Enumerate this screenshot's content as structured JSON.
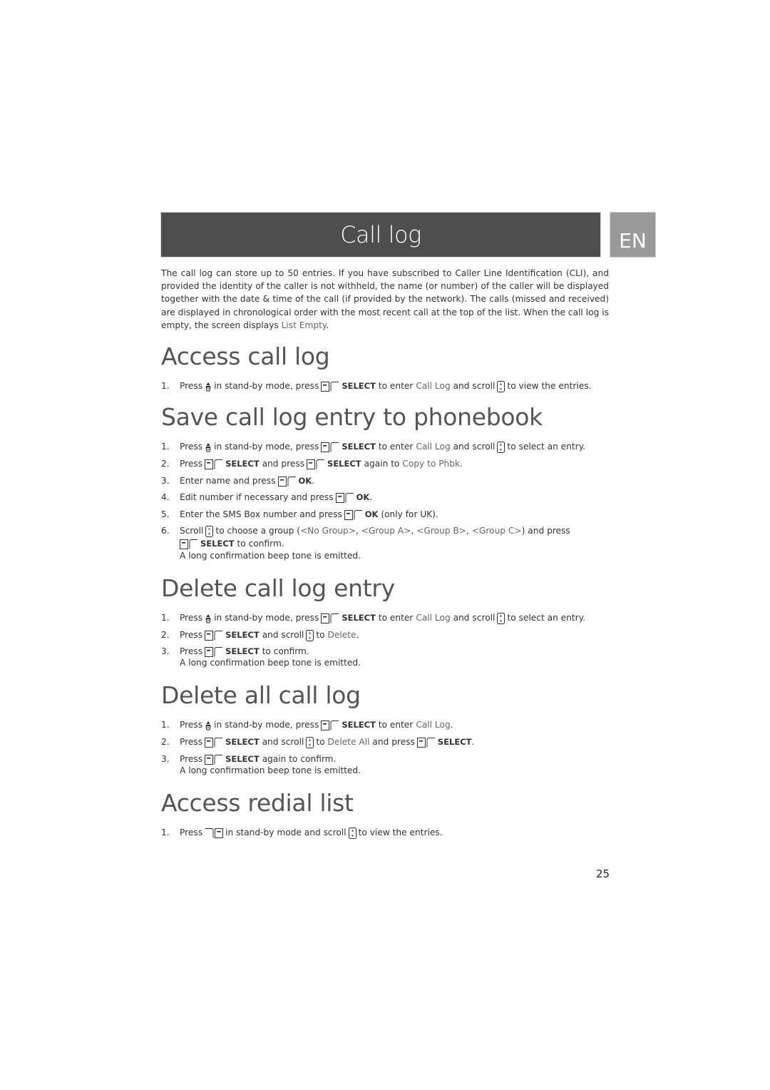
{
  "header": {
    "title": "Call log",
    "language": "EN"
  },
  "intro": "The call log can store up to 50 entries. If you have subscribed to Caller Line Identification (CLI), and provided the identity of the caller is not withheld, the name (or number) of the caller will be displayed together with the date & time of the call (if provided by the network). The calls (missed and received) are displayed in chronological order with the most recent call at the top of the list. When the call log is empty, the screen displays ",
  "intro_menu": "List Empty",
  "intro_end": ".",
  "sections": {
    "access_call_log": {
      "title": "Access call log",
      "steps": [
        {
          "num": "1.",
          "parts": [
            "Press",
            "in stand-by mode, press",
            "SELECT",
            "to enter",
            "Call Log",
            "and scroll",
            "to view the entries."
          ]
        }
      ]
    },
    "save_entry": {
      "title": "Save call log entry to phonebook",
      "steps": [
        {
          "num": "1.",
          "parts": [
            "Press",
            "in stand-by mode, press",
            "SELECT",
            "to enter",
            "Call Log",
            "and scroll",
            "to select an entry."
          ]
        },
        {
          "num": "2.",
          "parts": [
            "Press",
            "SELECT",
            "and press",
            "SELECT",
            "again to",
            "Copy to Phbk",
            "."
          ]
        },
        {
          "num": "3.",
          "parts": [
            "Enter name and press",
            "OK",
            "."
          ]
        },
        {
          "num": "4.",
          "parts": [
            "Edit number if necessary and press",
            "OK",
            "."
          ]
        },
        {
          "num": "5.",
          "parts": [
            "Enter the SMS Box number and press",
            "OK",
            "(only for UK)."
          ]
        },
        {
          "num": "6.",
          "parts": [
            "Scroll",
            "to choose a group (",
            "<No Group>",
            ", ",
            "<Group A>",
            ", ",
            "<Group B>",
            ", ",
            "<Group C>",
            ") and press",
            "SELECT",
            "to confirm."
          ]
        }
      ],
      "note": "A long confirmation beep tone is emitted."
    },
    "delete_entry": {
      "title": "Delete call log entry",
      "steps": [
        {
          "num": "1.",
          "parts": [
            "Press",
            "in stand-by mode, press",
            "SELECT",
            "to enter",
            "Call Log",
            "and scroll",
            "to select an entry."
          ]
        },
        {
          "num": "2.",
          "parts": [
            "Press",
            "SELECT",
            "and scroll",
            "to",
            "Delete",
            "."
          ]
        },
        {
          "num": "3.",
          "parts": [
            "Press",
            "SELECT",
            "to confirm."
          ]
        }
      ],
      "note": "A long confirmation beep tone is emitted."
    },
    "delete_all": {
      "title": "Delete all call log",
      "steps": [
        {
          "num": "1.",
          "parts": [
            "Press",
            "in stand-by mode, press",
            "SELECT",
            "to enter",
            "Call Log",
            "."
          ]
        },
        {
          "num": "2.",
          "parts": [
            "Press",
            "SELECT",
            "and scroll",
            "to",
            "Delete All",
            "and press",
            "SELECT",
            "."
          ]
        },
        {
          "num": "3.",
          "parts": [
            "Press",
            "SELECT",
            "again to confirm."
          ]
        }
      ],
      "note": "A long confirmation beep tone is emitted."
    },
    "redial": {
      "title": "Access redial list",
      "steps": [
        {
          "num": "1.",
          "parts": [
            "Press",
            "in stand-by mode and scroll",
            "to view the entries."
          ]
        }
      ]
    }
  },
  "icons": {
    "calllog_key": "call-log-key-icon",
    "left_softkey": "left-softkey-icon",
    "scroll_key": "scroll-key-icon",
    "right_softkey": "right-softkey-icon"
  },
  "page_number": "25"
}
